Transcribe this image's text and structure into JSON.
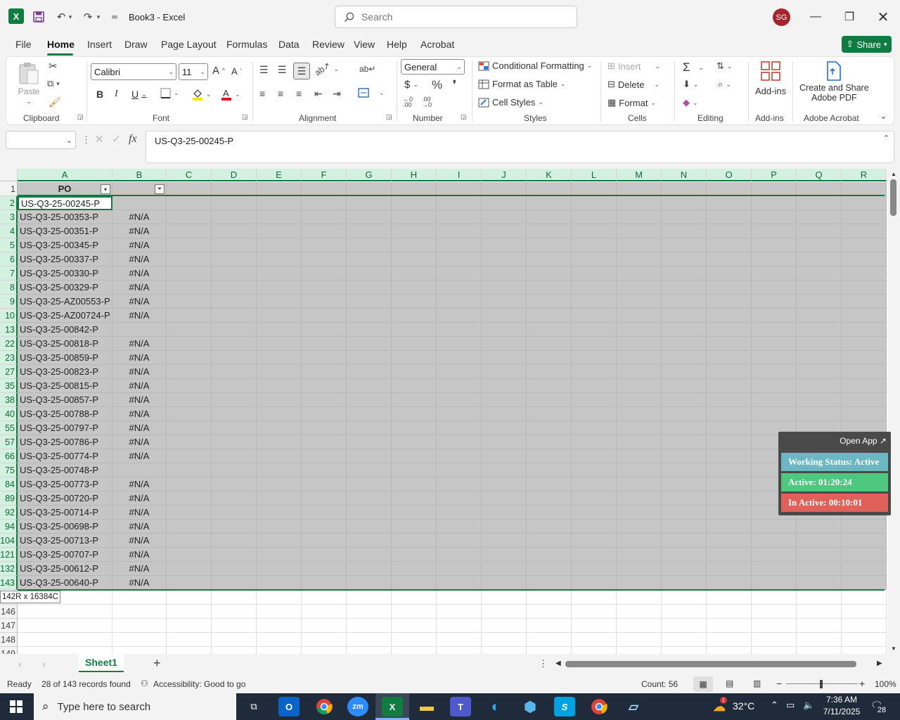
{
  "window": {
    "title": "Book3  -  Excel",
    "search_placeholder": "Search",
    "user_initials": "SG"
  },
  "menu": {
    "items": [
      "File",
      "Home",
      "Insert",
      "Draw",
      "Page Layout",
      "Formulas",
      "Data",
      "Review",
      "View",
      "Help",
      "Acrobat"
    ],
    "share_label": "Share"
  },
  "ribbon": {
    "clipboard": {
      "paste": "Paste",
      "label": "Clipboard"
    },
    "font": {
      "name": "Calibri",
      "size": "11",
      "label": "Font",
      "bold": "B",
      "italic": "I",
      "underline": "U"
    },
    "alignment": {
      "label": "Alignment"
    },
    "number": {
      "format": "General",
      "label": "Number"
    },
    "styles": {
      "conditional": "Conditional Formatting",
      "table": "Format as Table",
      "cell_styles": "Cell Styles",
      "label": "Styles"
    },
    "cells": {
      "insert": "Insert",
      "delete": "Delete",
      "format": "Format",
      "label": "Cells"
    },
    "editing": {
      "label": "Editing"
    },
    "addins": {
      "button": "Add-ins",
      "label": "Add-ins"
    },
    "acrobat": {
      "button_line1": "Create and Share",
      "button_line2": "Adobe PDF",
      "label": "Adobe Acrobat"
    }
  },
  "formula_bar": {
    "name_box": "",
    "fx": "fx",
    "value": "US-Q3-25-00245-P"
  },
  "sheet": {
    "columns": [
      "A",
      "B",
      "C",
      "D",
      "E",
      "F",
      "G",
      "H",
      "I",
      "J",
      "K",
      "L",
      "M",
      "N",
      "O",
      "P",
      "Q",
      "R"
    ],
    "header_row_num": "1",
    "header_a": "PO",
    "rows": [
      {
        "n": "2",
        "a": "US-Q3-25-00245-P",
        "b": ""
      },
      {
        "n": "3",
        "a": "US-Q3-25-00353-P",
        "b": "#N/A"
      },
      {
        "n": "4",
        "a": "US-Q3-25-00351-P",
        "b": "#N/A"
      },
      {
        "n": "5",
        "a": "US-Q3-25-00345-P",
        "b": "#N/A"
      },
      {
        "n": "6",
        "a": "US-Q3-25-00337-P",
        "b": "#N/A"
      },
      {
        "n": "7",
        "a": "US-Q3-25-00330-P",
        "b": "#N/A"
      },
      {
        "n": "8",
        "a": "US-Q3-25-00329-P",
        "b": "#N/A"
      },
      {
        "n": "9",
        "a": "US-Q3-25-AZ00553-P",
        "b": "#N/A"
      },
      {
        "n": "10",
        "a": "US-Q3-25-AZ00724-P",
        "b": "#N/A"
      },
      {
        "n": "13",
        "a": "US-Q3-25-00842-P",
        "b": ""
      },
      {
        "n": "22",
        "a": "US-Q3-25-00818-P",
        "b": "#N/A"
      },
      {
        "n": "23",
        "a": "US-Q3-25-00859-P",
        "b": "#N/A"
      },
      {
        "n": "27",
        "a": "US-Q3-25-00823-P",
        "b": "#N/A"
      },
      {
        "n": "35",
        "a": "US-Q3-25-00815-P",
        "b": "#N/A"
      },
      {
        "n": "38",
        "a": "US-Q3-25-00857-P",
        "b": "#N/A"
      },
      {
        "n": "40",
        "a": "US-Q3-25-00788-P",
        "b": "#N/A"
      },
      {
        "n": "55",
        "a": "US-Q3-25-00797-P",
        "b": "#N/A"
      },
      {
        "n": "57",
        "a": "US-Q3-25-00786-P",
        "b": "#N/A"
      },
      {
        "n": "66",
        "a": "US-Q3-25-00774-P",
        "b": "#N/A"
      },
      {
        "n": "75",
        "a": "US-Q3-25-00748-P",
        "b": ""
      },
      {
        "n": "84",
        "a": "US-Q3-25-00773-P",
        "b": "#N/A"
      },
      {
        "n": "89",
        "a": "US-Q3-25-00720-P",
        "b": "#N/A"
      },
      {
        "n": "92",
        "a": "US-Q3-25-00714-P",
        "b": "#N/A"
      },
      {
        "n": "94",
        "a": "US-Q3-25-00698-P",
        "b": "#N/A"
      },
      {
        "n": "104",
        "a": "US-Q3-25-00713-P",
        "b": "#N/A"
      },
      {
        "n": "121",
        "a": "US-Q3-25-00707-P",
        "b": "#N/A"
      },
      {
        "n": "132",
        "a": "US-Q3-25-00612-P",
        "b": "#N/A"
      },
      {
        "n": "143",
        "a": "US-Q3-25-00640-P",
        "b": "#N/A"
      }
    ],
    "selection_tooltip": "142R x 16384C",
    "empty_rows": [
      "146",
      "147",
      "148",
      "149"
    ]
  },
  "widget": {
    "open_app": "Open App ↗",
    "status": "Working Status: Active",
    "active": "Active: 01:20:24",
    "inactive": "In Active: 00:10:01",
    "colors": {
      "status": "#6bb7c4",
      "active": "#4fc77f",
      "inactive": "#e0615a"
    }
  },
  "sheet_tabs": {
    "active": "Sheet1",
    "add": "+"
  },
  "status_bar": {
    "ready": "Ready",
    "records": "28 of 143 records found",
    "accessibility": "Accessibility: Good to go",
    "count": "Count: 56",
    "zoom": "100%"
  },
  "taskbar": {
    "search_placeholder": "Type here to search",
    "temp": "32°C",
    "time": "7:36 AM",
    "date": "7/11/2025",
    "notifications": "28",
    "weather_badge": "1"
  }
}
